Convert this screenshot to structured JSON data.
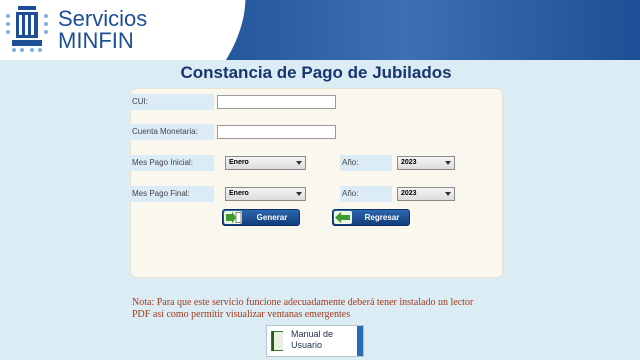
{
  "header": {
    "brand_line1": "Servicios",
    "brand_line2": "MINFIN"
  },
  "page_title": "Constancia de Pago de Jubilados",
  "form": {
    "cui_label": "CUI:",
    "cui_value": "",
    "cuenta_label": "Cuenta Monetaria:",
    "cuenta_value": "",
    "mes_inicial_label": "Mes Pago Inicial:",
    "mes_inicial_value": "Enero",
    "anio_inicial_label": "Año:",
    "anio_inicial_value": "2023",
    "mes_final_label": "Mes Pago Final:",
    "mes_final_value": "Enero",
    "anio_final_label": "Año:",
    "anio_final_value": "2023"
  },
  "buttons": {
    "generar": "Generar",
    "regresar": "Regresar"
  },
  "note_line1": "Nota: Para que este servicio funcione adecuadamente deberá tener instalado un lector",
  "note_line2": "PDF así como permitir visualizar ventanas emergentes",
  "manual": {
    "line1": "Manual de",
    "line2": "Usuario"
  },
  "colors": {
    "header_blue": "#1d4f96",
    "title_navy": "#17356e",
    "note_red": "#a23a1c",
    "background": "#dcecf5"
  }
}
